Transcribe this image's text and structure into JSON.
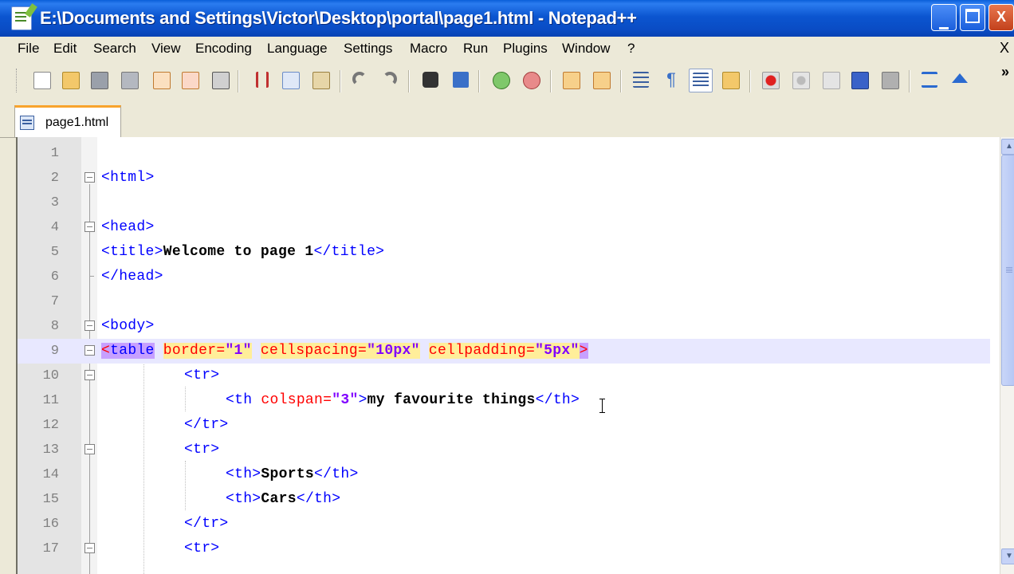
{
  "window": {
    "title": "E:\\Documents and Settings\\Victor\\Desktop\\portal\\page1.html - Notepad++",
    "buttons": {
      "minimize": "_",
      "maximize": "□",
      "close": "X"
    }
  },
  "menu": {
    "items": [
      "File",
      "Edit",
      "Search",
      "View",
      "Encoding",
      "Language",
      "Settings",
      "Macro",
      "Run",
      "Plugins",
      "Window",
      "?"
    ],
    "close": "X"
  },
  "toolbar": {
    "icons": [
      "new-file-icon",
      "open-file-icon",
      "save-icon",
      "save-all-icon",
      "close-icon",
      "close-all-icon",
      "print-icon",
      "cut-icon",
      "copy-icon",
      "paste-icon",
      "undo-icon",
      "redo-icon",
      "find-icon",
      "replace-icon",
      "zoom-in-icon",
      "zoom-out-icon",
      "sync-vertical-icon",
      "sync-horizontal-icon",
      "word-wrap-icon",
      "show-all-chars-icon",
      "indent-guide-icon",
      "user-lang-icon",
      "record-macro-icon",
      "stop-macro-icon",
      "play-macro-icon",
      "run-macro-multiple-icon",
      "save-macro-icon",
      "trim-icon",
      "collapse-icon"
    ],
    "more": "»"
  },
  "tab": {
    "label": "page1.html"
  },
  "editor": {
    "lines": [
      {
        "n": "1"
      },
      {
        "n": "2"
      },
      {
        "n": "3"
      },
      {
        "n": "4"
      },
      {
        "n": "5"
      },
      {
        "n": "6"
      },
      {
        "n": "7"
      },
      {
        "n": "8"
      },
      {
        "n": "9"
      },
      {
        "n": "10"
      },
      {
        "n": "11"
      },
      {
        "n": "12"
      },
      {
        "n": "13"
      },
      {
        "n": "14"
      },
      {
        "n": "15"
      },
      {
        "n": "16"
      },
      {
        "n": "17"
      }
    ],
    "code": {
      "l2_tag": "<html>",
      "l4_tag": "<head>",
      "l5_open": "<title>",
      "l5_text": "Welcome to page 1",
      "l5_close": "</title>",
      "l6_tag": "</head>",
      "l8_tag": "<body>",
      "l9_lt": "<",
      "l9_tag": "table",
      "l9_a1": "border=",
      "l9_v1": "\"1\"",
      "l9_a2": "cellspacing=",
      "l9_v2": "\"10px\"",
      "l9_a3": "cellpadding=",
      "l9_v3": "\"5px\"",
      "l9_gt": ">",
      "l10_tag": "<tr>",
      "l11_open": "<th ",
      "l11_attr": "colspan=",
      "l11_val": "\"3\"",
      "l11_gt": ">",
      "l11_text": "my favourite things",
      "l11_close": "</th>",
      "l12_tag": "</tr>",
      "l13_tag": "<tr>",
      "l14_open": "<th>",
      "l14_text": "Sports",
      "l14_close": "</th>",
      "l15_open": "<th>",
      "l15_text": "Cars",
      "l15_close": "</th>",
      "l16_tag": "</tr>",
      "l17_tag": "<tr>"
    },
    "current_line": 9
  },
  "colors": {
    "tag": "#0000ff",
    "attribute": "#ff0000",
    "value": "#8000ff",
    "current_line": "#e8e8ff",
    "tab_accent": "#f8a32c",
    "titlebar": "#0b55d0"
  }
}
